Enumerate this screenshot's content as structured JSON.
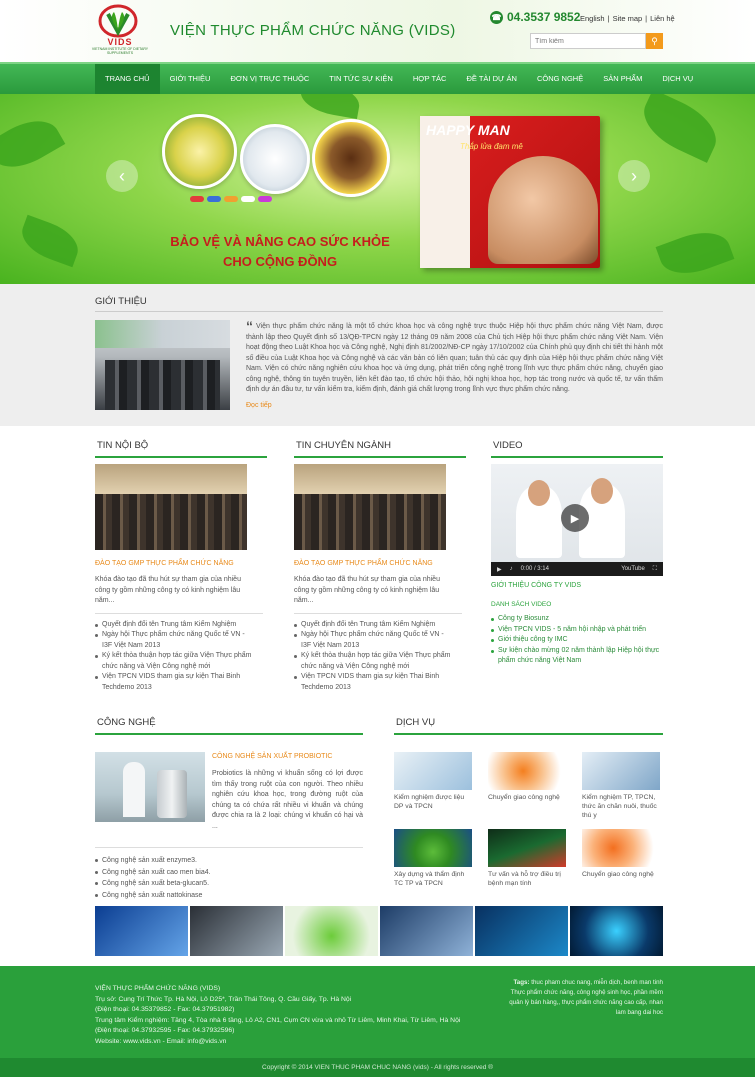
{
  "header": {
    "logo_text": "VIDS",
    "logo_sub": "VIETNAM INSTITUTE OF DIETARY SUPPLEMENTS",
    "site_title": "VIỆN THỰC PHẨM CHỨC NĂNG (VIDS)",
    "phone": "04.3537 9852",
    "toplinks": [
      "English",
      "Site map",
      "Liên hệ"
    ],
    "search_placeholder": "Tìm kiếm"
  },
  "nav": {
    "items": [
      "TRANG CHỦ",
      "GIỚI THIỆU",
      "ĐƠN VỊ TRỰC THUỘC",
      "TIN TỨC SỰ KIỆN",
      "HỢP TÁC",
      "ĐỀ TÀI DỰ ÁN",
      "CÔNG NGHỆ",
      "SẢN PHẨM",
      "DỊCH VỤ"
    ],
    "active_index": 0
  },
  "banner": {
    "slogan_line1": "BẢO VỆ VÀ NÂNG CAO SỨC KHỎE",
    "slogan_line2": "CHO CỘNG ĐỒNG",
    "product_title": "HAPPY MAN",
    "product_sub": "Thắp lửa đam mê"
  },
  "intro": {
    "heading": "GIỚI THIỆU",
    "quote": "“",
    "text": "Viện thực phẩm chức năng là một tổ chức khoa học và công nghệ trực thuộc Hiệp hội thực phẩm chức năng Việt Nam, được thành lập theo Quyết định số 13/QĐ-TPCN ngày 12 tháng 09 năm 2008 của Chủ tịch Hiệp hội thực phẩm chức năng Việt Nam. Viện hoạt động theo Luật Khoa học và Công nghệ, Nghị định 81/2002/NĐ-CP ngày 17/10/2002 của Chính phủ quy định chi tiết thi hành một số điều của Luật Khoa học và Công nghệ và các văn bản có liên quan; tuân thủ các quy định của Hiệp hội thực phẩm chức năng Việt Nam. Viện có chức năng nghiên cứu khoa học và ứng dụng, phát triển công nghệ trong lĩnh vực thực phẩm chức năng, chuyển giao công nghệ, thông tin tuyên truyền, liên kết đào tạo, tổ chức hội thảo, hội nghị khoa học, hợp tác trong nước và quốc tế, tư vấn thẩm định dự án đầu tư, tư vấn kiểm tra, kiểm định, đánh giá chất lượng trong lĩnh vực thực phẩm chức năng.",
    "more": "Đọc tiếp"
  },
  "news_internal": {
    "heading": "TIN NỘI BỘ",
    "title": "ĐÀO TẠO GMP THỰC PHẨM CHỨC NĂNG",
    "desc": "Khóa đào tạo đã thu hút sự tham gia của nhiều công ty gồm những công ty có kinh nghiệm lâu năm...",
    "items": [
      "Quyết định đổi tên Trung tâm Kiểm Nghiệm",
      "Ngày hội Thực phẩm chức năng Quốc tế VN - I3F Việt Nam 2013",
      "Ký kết thỏa thuận hợp tác giữa Viện Thực phẩm chức năng và Viện Công nghệ mới",
      "Viện TPCN VIDS tham gia sự kiện Thai Binh Techdemo 2013"
    ]
  },
  "news_industry": {
    "heading": "TIN CHUYÊN NGÀNH",
    "title": "ĐÀO TẠO GMP THỰC PHẨM CHỨC NĂNG",
    "desc": "Khóa đào tạo đã thu hút sự tham gia của nhiều công ty gồm những công ty có kinh nghiệm lâu năm...",
    "items": [
      "Quyết định đổi tên Trung tâm Kiểm Nghiệm",
      "Ngày hội Thực phẩm chức năng Quốc tế VN - I3F Việt Nam 2013",
      "Ký kết thỏa thuận hợp tác giữa Viện Thực phẩm chức năng và Viện Công nghệ mới",
      "Viện TPCN VIDS tham gia sự kiện Thai Binh Techdemo 2013"
    ]
  },
  "video": {
    "heading": "VIDEO",
    "time": "0:00 / 3:14",
    "yt": "YouTube",
    "link": "GIỚI THIỆU CÔNG TY VIDS",
    "list_heading": "DANH SÁCH VIDEO",
    "items": [
      "Công ty Biosunz",
      "Viện TPCN VIDS - 5 năm hội nhập và phát triển",
      "Giới thiệu công ty IMC",
      "Sự kiện chào mừng 02 năm thành lập Hiệp hội thực phẩm chức năng Việt Nam"
    ]
  },
  "tech": {
    "heading": "CÔNG NGHỆ",
    "title": "CÔNG NGHỆ SẢN XUẤT PROBIOTIC",
    "desc": "Probiotics là những vi khuẩn sống có lợi được tìm thấy trong ruột của con người. Theo nhiều nghiên cứu khoa học, trong đường ruột của chúng ta có chứa rất nhiều vi khuẩn và chúng được chia ra là 2 loại: chúng vi khuẩn có hại và ...",
    "items": [
      "Công nghệ sản xuất enzyme3.",
      "Công nghệ sản xuất cao men bia4.",
      "Công nghệ sản xuất beta-glucan5.",
      "Công nghệ sản xuất nattokinase"
    ]
  },
  "services": {
    "heading": "DỊCH VỤ",
    "items": [
      "Kiểm nghiệm được liệu DP và TPCN",
      "Chuyển giao công nghệ",
      "Kiểm nghiệm TP, TPCN, thức ăn chăn nuôi, thuốc thú y",
      "Xây dựng và thẩm định TC TP và TPCN",
      "Tư vấn và hỗ trợ điều trị bệnh mạn tính",
      "Chuyển giao công nghệ"
    ]
  },
  "footer": {
    "name": "VIỆN THỰC PHẨM CHỨC NĂNG (VIDS)",
    "lines": [
      "Trụ sở: Cung Trí Thức Tp. Hà Nội, Lô D25*, Trần Thái Tông, Q. Cầu Giấy, Tp. Hà Nội",
      "(Điện thoại: 04.35379852 - Fax: 04.37951982)",
      "Trung tâm Kiểm nghiệm: Tầng 4, Tòa nhà 6 tầng, Lô A2, CN1, Cụm CN vừa và nhỏ Từ Liêm, Minh Khai, Từ Liêm, Hà Nội",
      "(Điện thoại: 04.37932595 - Fax: 04.37932596)",
      "Website: www.vids.vn - Email: info@vids.vn"
    ],
    "tags_label": "Tags:",
    "tags": "thuc pham chuc nang, miễn dịch, benh man tinh Thực phẩm chức năng, công nghệ sinh học, phần mềm quản lý bán hàng,, thực phẩm chức năng cao cấp, nhan lam bang dai hoc",
    "copyright": "Copyright © 2014 VIEN THUC PHAM CHUC NANG (vids) - All rights reserved ®"
  },
  "colors": {
    "brand_green": "#2aa03b",
    "accent_orange": "#e88a1a",
    "logo_red": "#d0262b"
  }
}
